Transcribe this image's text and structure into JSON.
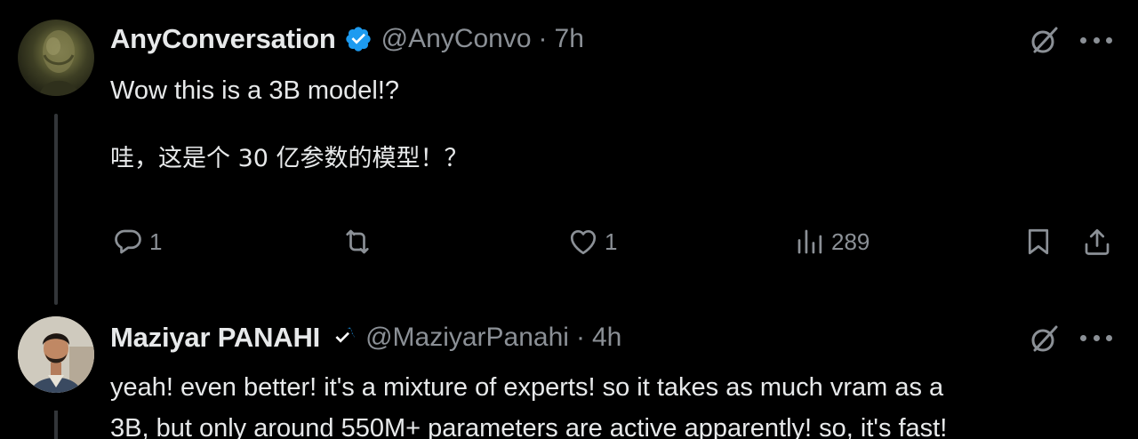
{
  "tweets": [
    {
      "author": {
        "name": "AnyConversation",
        "handle": "@AnyConvo",
        "separator": "·",
        "time": "7h",
        "avatar": "bronze-face-avatar"
      },
      "text_lines": [
        "Wow this is a 3B model!?",
        "哇，这是个 30 亿参数的模型！？"
      ],
      "actions": {
        "replies": "1",
        "retweets": "",
        "likes": "1",
        "views": "289"
      }
    },
    {
      "author": {
        "name": "Maziyar PANAHI",
        "handle": "@MaziyarPanahi",
        "separator": "·",
        "time": "4h",
        "avatar": "man-portrait-avatar"
      },
      "text_lines": [
        "yeah! even better! it's a mixture of experts! so it takes as much vram as a",
        "3B, but only around 550M+ parameters are active apparently! so, it's fast!"
      ]
    }
  ],
  "icons": [
    "verified-badge-icon",
    "grok-icon",
    "more-icon",
    "reply-icon",
    "retweet-icon",
    "like-icon",
    "views-icon",
    "bookmark-icon",
    "share-icon"
  ],
  "colors": {
    "background": "#000000",
    "text": "#e7e9ea",
    "muted": "#8b9096",
    "verified": "#1d9bf0",
    "thread_line": "#333639"
  }
}
